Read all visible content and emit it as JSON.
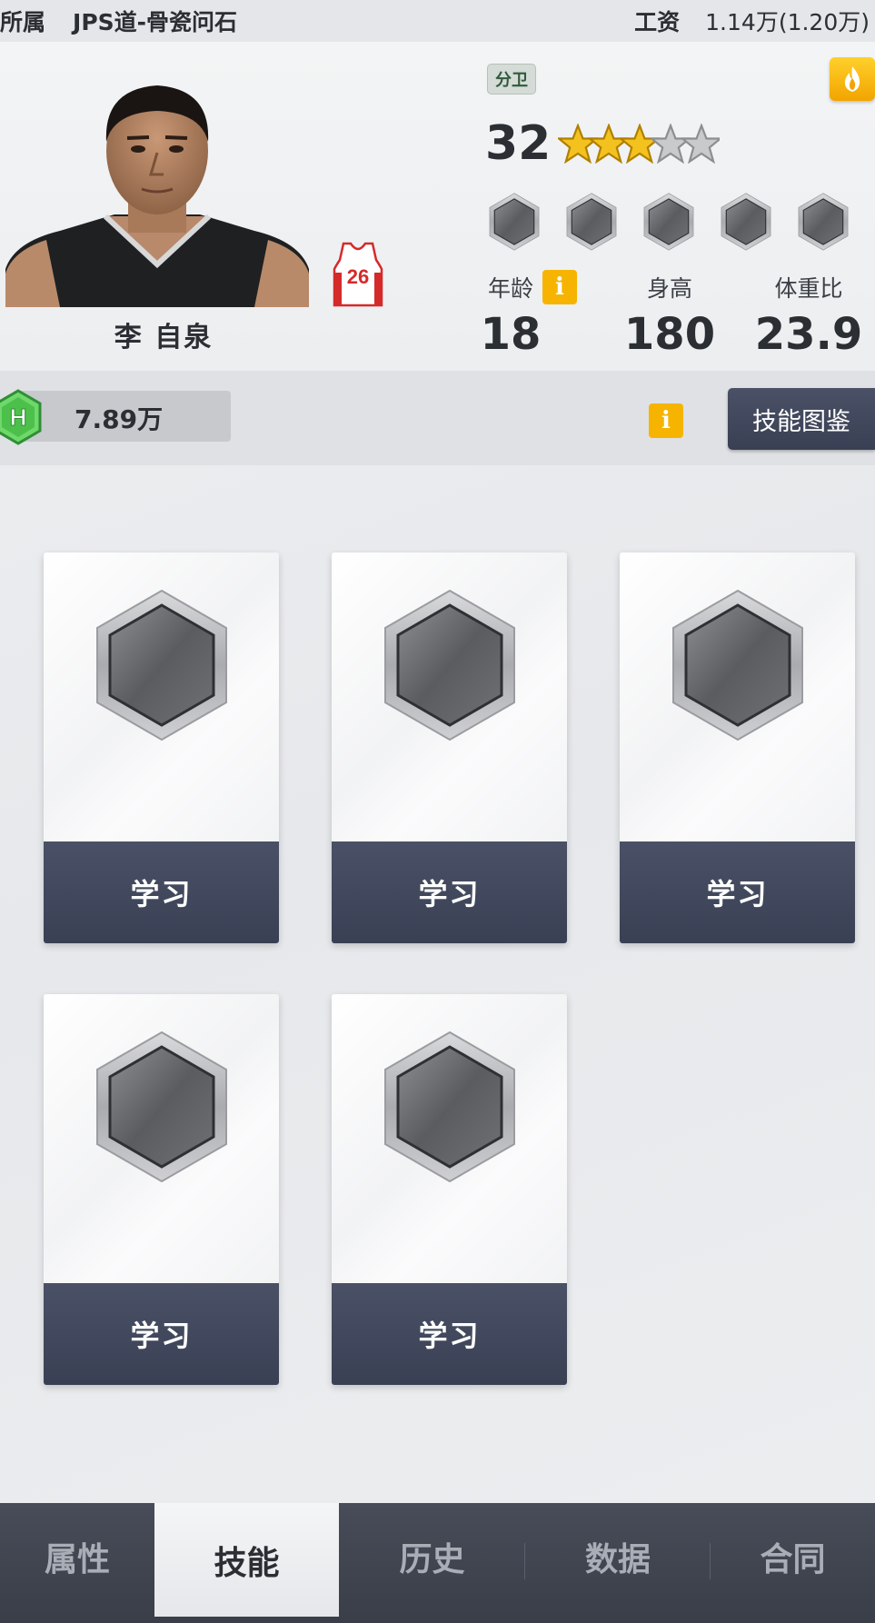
{
  "topbar": {
    "team_label": "所属",
    "team_name": "JPS道-骨瓷问石",
    "salary_label": "工资",
    "salary_value": "1.14万(1.20万)"
  },
  "player": {
    "name": "李 自泉",
    "jersey_number": "26",
    "position": "分卫",
    "overall": "32",
    "stars_filled": 3,
    "stars_total": 5,
    "skill_slots_shown": 5,
    "stats": [
      {
        "label": "年龄",
        "value": "18"
      },
      {
        "label": "身高",
        "value": "180"
      },
      {
        "label": "体重比",
        "value": "23.9"
      }
    ]
  },
  "currency": {
    "icon": "h-coin-icon",
    "value": "7.89万",
    "guide_button": "技能图鉴"
  },
  "skill_cards": [
    {
      "button": "学习"
    },
    {
      "button": "学习"
    },
    {
      "button": "学习"
    },
    {
      "button": "学习"
    },
    {
      "button": "学习"
    }
  ],
  "tabs": [
    {
      "label": "属性",
      "active": false
    },
    {
      "label": "技能",
      "active": true
    },
    {
      "label": "历史",
      "active": false
    },
    {
      "label": "数据",
      "active": false
    },
    {
      "label": "合同",
      "active": false
    }
  ],
  "colors": {
    "accent_yellow": "#f6b400",
    "button_navy": "#3f4559",
    "coin_green": "#4cc04a"
  }
}
